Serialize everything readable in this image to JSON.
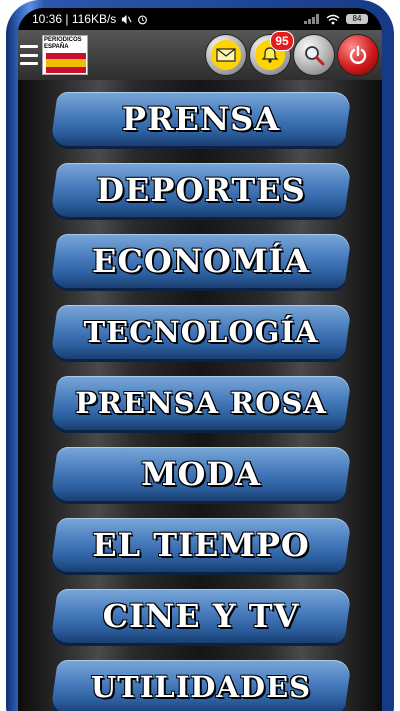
{
  "status_bar": {
    "time_speed": "10:36 | 116KB/s",
    "battery": "84"
  },
  "app_bar": {
    "logo_line1": "PERIODICOS",
    "logo_line2": "ESPAÑA",
    "notification_count": "95"
  },
  "menu": {
    "items": [
      {
        "label": "PRENSA"
      },
      {
        "label": "DEPORTES"
      },
      {
        "label": "ECONOMÍA"
      },
      {
        "label": "TECNOLOGÍA"
      },
      {
        "label": "PRENSA ROSA"
      },
      {
        "label": "MODA"
      },
      {
        "label": "EL TIEMPO"
      },
      {
        "label": "CINE Y TV"
      },
      {
        "label": "UTILIDADES"
      }
    ]
  },
  "colors": {
    "button_blue": "#2c5f9f",
    "badge_red": "#e51c1c",
    "mail_yellow": "#ffd400"
  },
  "icons": [
    "hamburger-menu-icon",
    "mail-icon",
    "bell-icon",
    "search-icon",
    "power-icon",
    "alarm-icon",
    "wifi-icon",
    "signal-icon"
  ]
}
